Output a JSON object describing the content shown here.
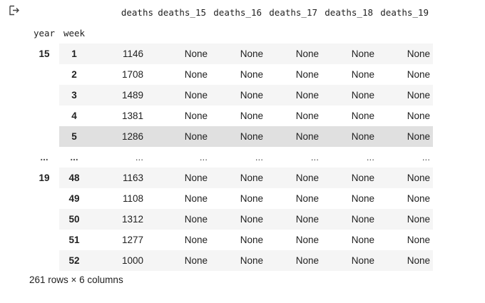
{
  "columns": [
    "deaths",
    "deaths_15",
    "deaths_16",
    "deaths_17",
    "deaths_18",
    "deaths_19"
  ],
  "index_names": [
    "year",
    "week"
  ],
  "rows_top": [
    {
      "year": "15",
      "week": "1",
      "deaths": "1146",
      "d15": "None",
      "d16": "None",
      "d17": "None",
      "d18": "None",
      "d19": "None"
    },
    {
      "year": "",
      "week": "2",
      "deaths": "1708",
      "d15": "None",
      "d16": "None",
      "d17": "None",
      "d18": "None",
      "d19": "None"
    },
    {
      "year": "",
      "week": "3",
      "deaths": "1489",
      "d15": "None",
      "d16": "None",
      "d17": "None",
      "d18": "None",
      "d19": "None"
    },
    {
      "year": "",
      "week": "4",
      "deaths": "1381",
      "d15": "None",
      "d16": "None",
      "d17": "None",
      "d18": "None",
      "d19": "None"
    },
    {
      "year": "",
      "week": "5",
      "deaths": "1286",
      "d15": "None",
      "d16": "None",
      "d17": "None",
      "d18": "None",
      "d19": "None"
    }
  ],
  "ellipsis_row": {
    "year": "...",
    "week": "...",
    "deaths": "...",
    "d15": "...",
    "d16": "...",
    "d17": "...",
    "d18": "...",
    "d19": "..."
  },
  "rows_bottom": [
    {
      "year": "19",
      "week": "48",
      "deaths": "1163",
      "d15": "None",
      "d16": "None",
      "d17": "None",
      "d18": "None",
      "d19": "None"
    },
    {
      "year": "",
      "week": "49",
      "deaths": "1108",
      "d15": "None",
      "d16": "None",
      "d17": "None",
      "d18": "None",
      "d19": "None"
    },
    {
      "year": "",
      "week": "50",
      "deaths": "1312",
      "d15": "None",
      "d16": "None",
      "d17": "None",
      "d18": "None",
      "d19": "None"
    },
    {
      "year": "",
      "week": "51",
      "deaths": "1277",
      "d15": "None",
      "d16": "None",
      "d17": "None",
      "d18": "None",
      "d19": "None"
    },
    {
      "year": "",
      "week": "52",
      "deaths": "1000",
      "d15": "None",
      "d16": "None",
      "d17": "None",
      "d18": "None",
      "d19": "None"
    }
  ],
  "summary": "261 rows × 6 columns",
  "icons": {
    "output": "output-redirect-icon"
  },
  "colors": {
    "row_alt": "#f5f5f5",
    "row_hover": "#e0e0e0",
    "text": "#212121"
  }
}
